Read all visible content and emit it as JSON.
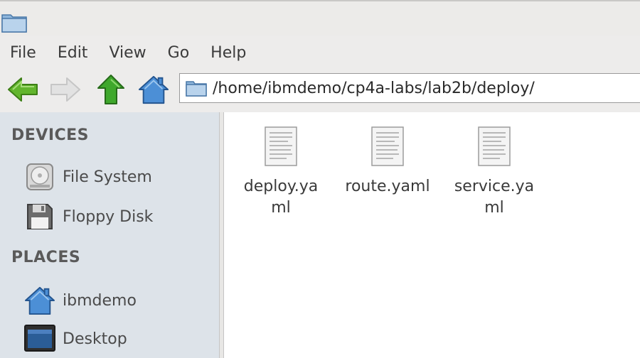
{
  "menu": [
    "File",
    "Edit",
    "View",
    "Go",
    "Help"
  ],
  "location": {
    "path": "/home/ibmdemo/cp4a-labs/lab2b/deploy/"
  },
  "sidebar": {
    "devices_heading": "DEVICES",
    "devices": [
      {
        "label": "File System",
        "icon": "harddisk-icon"
      },
      {
        "label": "Floppy Disk",
        "icon": "floppy-icon"
      }
    ],
    "places_heading": "PLACES",
    "places": [
      {
        "label": "ibmdemo",
        "icon": "home-icon"
      },
      {
        "label": "Desktop",
        "icon": "desktop-icon"
      }
    ]
  },
  "files": [
    {
      "name": "deploy.yaml",
      "icon": "text-file-icon"
    },
    {
      "name": "route.yaml",
      "icon": "text-file-icon"
    },
    {
      "name": "service.yaml",
      "icon": "text-file-icon"
    }
  ],
  "colors": {
    "back_arrow": "#5fb32a",
    "up_arrow": "#3fa82c",
    "home": "#3f80c8",
    "sidebar_bg": "#dde3e9"
  }
}
